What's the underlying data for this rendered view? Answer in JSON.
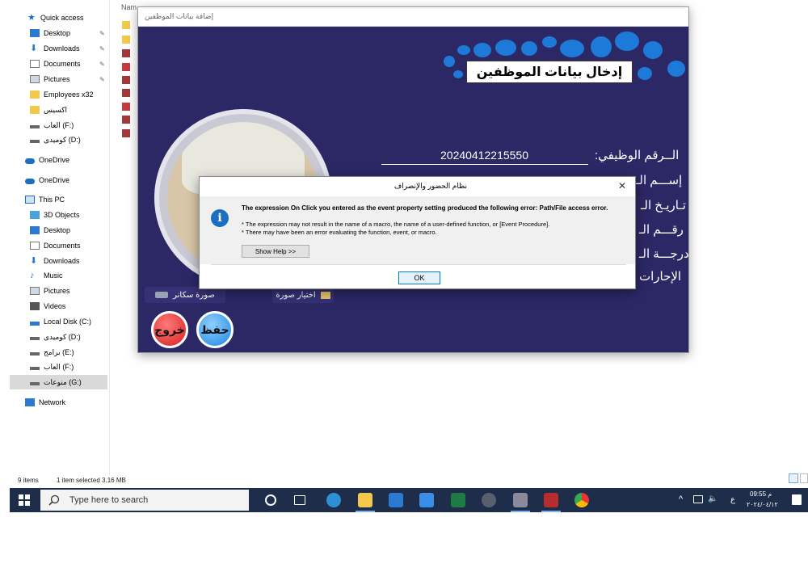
{
  "explorer": {
    "list_header": "Nam",
    "nav_items": [
      {
        "label": "Quick access",
        "icon": "star-icon"
      },
      {
        "label": "Desktop",
        "icon": "desktop-icon"
      },
      {
        "label": "Downloads",
        "icon": "download-icon"
      },
      {
        "label": "Documents",
        "icon": "documents-icon"
      },
      {
        "label": "Pictures",
        "icon": "pictures-icon"
      },
      {
        "label": "Employees x32",
        "icon": "folder-icon"
      },
      {
        "label": "اكسيس",
        "icon": "folder-icon"
      },
      {
        "label": "العاب (F:)",
        "icon": "drive-icon"
      },
      {
        "label": "كوميدى (D:)",
        "icon": "drive-icon"
      },
      {
        "label": "OneDrive",
        "icon": "cloud-icon"
      },
      {
        "label": "OneDrive",
        "icon": "cloud-icon"
      },
      {
        "label": "This PC",
        "icon": "computer-icon"
      },
      {
        "label": "3D Objects",
        "icon": "cube-icon"
      },
      {
        "label": "Desktop",
        "icon": "desktop-icon"
      },
      {
        "label": "Documents",
        "icon": "documents-icon"
      },
      {
        "label": "Downloads",
        "icon": "download-icon"
      },
      {
        "label": "Music",
        "icon": "music-icon"
      },
      {
        "label": "Pictures",
        "icon": "pictures-icon"
      },
      {
        "label": "Videos",
        "icon": "video-icon"
      },
      {
        "label": "Local Disk (C:)",
        "icon": "drive-icon"
      },
      {
        "label": "كوميدى (D:)",
        "icon": "drive-icon"
      },
      {
        "label": "برامج (E:)",
        "icon": "drive-icon"
      },
      {
        "label": "العاب (F:)",
        "icon": "drive-icon"
      },
      {
        "label": "منوعات (G:)",
        "icon": "drive-icon"
      },
      {
        "label": "Network",
        "icon": "network-icon"
      }
    ],
    "status_items": "9 items",
    "status_selected": "1 item selected  3.16 MB"
  },
  "taskbar": {
    "search_placeholder": "Type here to search",
    "tray_lang": "ع",
    "tray_time": "09:55 م",
    "tray_date": "٢٠٢٤/٠٤/١٢"
  },
  "form": {
    "window_title": "إضافة بيانات الموظفين",
    "header_title": "إدخال بيانات الموظفين",
    "fields": {
      "employee_no_label": "الــرقم الوظيفي:",
      "employee_no_value": "20240412215550",
      "name_label": "إســـم الـ",
      "birth_label": "تـاريـخ الـ",
      "number_label": "رقـــم الـ",
      "grade_label": "درجـــة الـ",
      "admin_label": "الإحارات"
    },
    "scanner_button": "صورة سكانر",
    "choose_image_button": "اختيار صورة",
    "save_button": "حفظ",
    "exit_button": "خروج"
  },
  "dialog": {
    "title": "نظام الحضور والإنصراف",
    "main_message": "The expression On Click you entered as the event property setting produced the following error: Path/File access error.",
    "detail_1": "* The expression may not result in the name of a macro, the name of a user-defined function, or [Event Procedure].",
    "detail_2": "* There may have been an error evaluating the function, event, or macro.",
    "help_button": "Show Help >>",
    "ok_button": "OK",
    "close_symbol": "✕",
    "info_symbol": "i"
  },
  "colors": {
    "form_bg": "#2c2866",
    "taskbar_bg": "#1e2e4a",
    "accent_blue": "#1e7ad8",
    "exit_red": "#d71f1f",
    "save_blue": "#1d86e0"
  }
}
